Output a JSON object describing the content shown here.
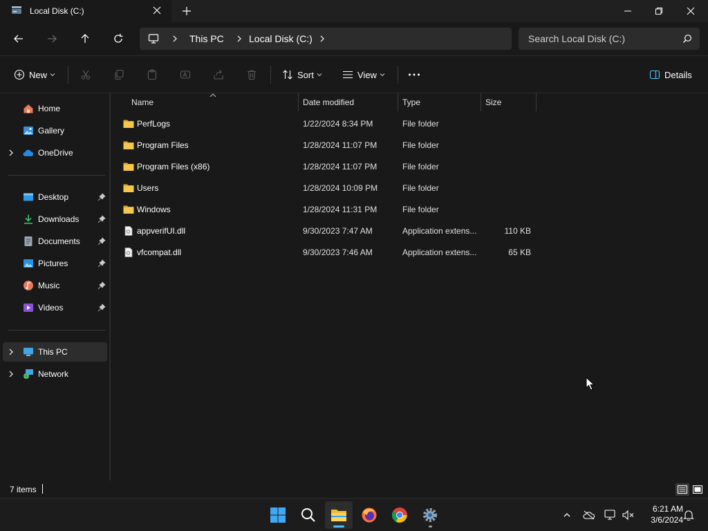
{
  "window": {
    "tab_title": "Local Disk (C:)"
  },
  "address": {
    "crumbs": [
      "This PC",
      "Local Disk (C:)"
    ]
  },
  "search": {
    "placeholder": "Search Local Disk (C:)"
  },
  "toolbar": {
    "new_label": "New",
    "sort_label": "Sort",
    "view_label": "View",
    "details_label": "Details"
  },
  "sidebar": {
    "items": [
      {
        "label": "Home",
        "icon": "home-icon"
      },
      {
        "label": "Gallery",
        "icon": "gallery-icon"
      },
      {
        "label": "OneDrive",
        "icon": "onedrive-icon"
      },
      {
        "label": "Desktop",
        "icon": "desktop-icon"
      },
      {
        "label": "Downloads",
        "icon": "downloads-icon"
      },
      {
        "label": "Documents",
        "icon": "documents-icon"
      },
      {
        "label": "Pictures",
        "icon": "pictures-icon"
      },
      {
        "label": "Music",
        "icon": "music-icon"
      },
      {
        "label": "Videos",
        "icon": "videos-icon"
      },
      {
        "label": "This PC",
        "icon": "this-pc-icon"
      },
      {
        "label": "Network",
        "icon": "network-icon"
      }
    ]
  },
  "files": {
    "columns": [
      "Name",
      "Date modified",
      "Type",
      "Size"
    ],
    "rows": [
      {
        "name": "PerfLogs",
        "date": "1/22/2024 8:34 PM",
        "type": "File folder",
        "size": "",
        "kind": "folder"
      },
      {
        "name": "Program Files",
        "date": "1/28/2024 11:07 PM",
        "type": "File folder",
        "size": "",
        "kind": "folder"
      },
      {
        "name": "Program Files (x86)",
        "date": "1/28/2024 11:07 PM",
        "type": "File folder",
        "size": "",
        "kind": "folder"
      },
      {
        "name": "Users",
        "date": "1/28/2024 10:09 PM",
        "type": "File folder",
        "size": "",
        "kind": "folder"
      },
      {
        "name": "Windows",
        "date": "1/28/2024 11:31 PM",
        "type": "File folder",
        "size": "",
        "kind": "folder"
      },
      {
        "name": "appverifUI.dll",
        "date": "9/30/2023 7:47 AM",
        "type": "Application extens...",
        "size": "110 KB",
        "kind": "file"
      },
      {
        "name": "vfcompat.dll",
        "date": "9/30/2023 7:46 AM",
        "type": "Application extens...",
        "size": "65 KB",
        "kind": "file"
      }
    ]
  },
  "status": {
    "item_count": "7 items"
  },
  "taskbar": {
    "time": "6:21 AM",
    "date": "3/6/2024"
  },
  "colors": {
    "accent": "#4cc2ff",
    "folder": "#f3c24a",
    "background": "#191919"
  }
}
